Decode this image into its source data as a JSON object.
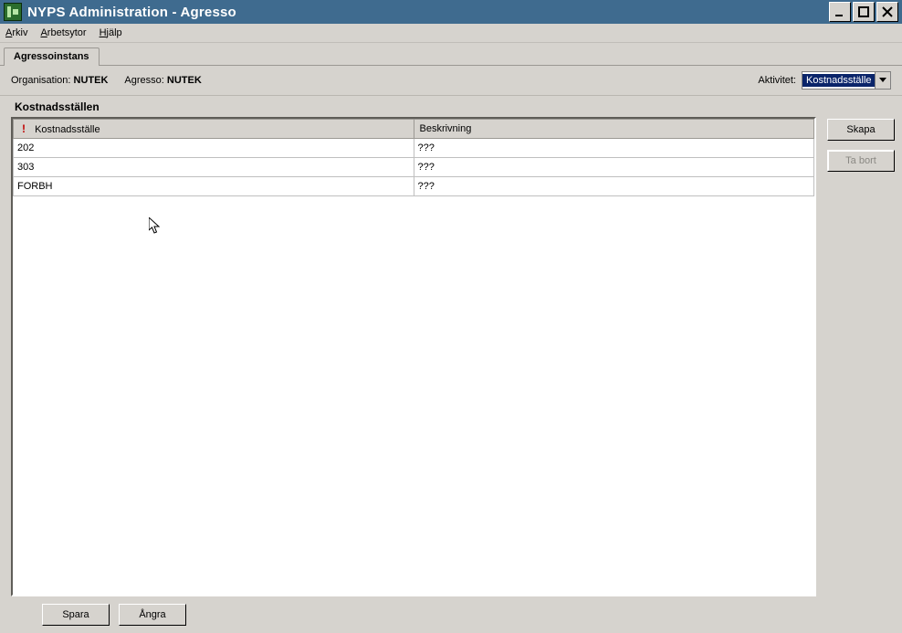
{
  "window": {
    "title": "NYPS Administration - Agresso"
  },
  "menu": {
    "arkiv_u": "A",
    "arkiv_rest": "rkiv",
    "arbetsytor_u": "A",
    "arbetsytor_rest": "rbetsytor",
    "hjalp_u": "H",
    "hjalp_rest": "jälp"
  },
  "tab": {
    "label": "Agressoinstans"
  },
  "info": {
    "organisation_label": "Organisation:",
    "organisation_value": "NUTEK",
    "agresso_label": "Agresso:",
    "agresso_value": "NUTEK",
    "aktivitet_label": "Aktivitet:",
    "aktivitet_value": "Kostnadsställe"
  },
  "section": {
    "title": "Kostnadsställen"
  },
  "table": {
    "col1": "Kostnadsställe",
    "col2": "Beskrivning",
    "rows": [
      {
        "c1": "202",
        "c2": "???"
      },
      {
        "c1": "303",
        "c2": "???"
      },
      {
        "c1": "FORBH",
        "c2": "???"
      }
    ]
  },
  "buttons": {
    "skapa": "Skapa",
    "tabort": "Ta bort",
    "spara": "Spara",
    "angra": "Ångra"
  }
}
